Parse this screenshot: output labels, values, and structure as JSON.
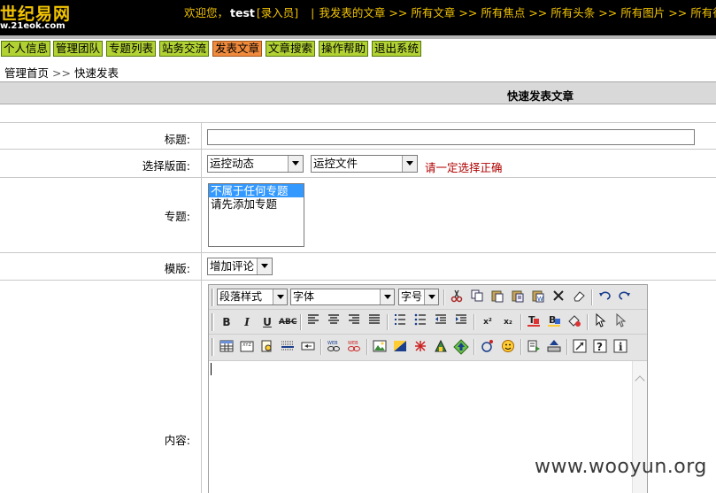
{
  "header": {
    "logo_text": "世纪易网",
    "logo_url": "w.21eok.com",
    "welcome_prefix": "欢迎您，",
    "username": "test",
    "role": "[录入员]",
    "links": [
      "我发表的文章",
      "所有文章",
      "所有焦点",
      "所有头条",
      "所有图片",
      "所有待审"
    ],
    "arrow": ">>"
  },
  "nav": {
    "buttons": [
      "个人信息",
      "管理团队",
      "专题列表",
      "站务交流",
      "发表文章",
      "文章搜索",
      "操作帮助",
      "退出系统"
    ],
    "active_index": 4
  },
  "breadcrumb": {
    "home": "管理首页",
    "arrow": ">>",
    "current": "快速发表"
  },
  "panel": {
    "title": "快速发表文章"
  },
  "form": {
    "title_label": "标题:",
    "title_value": "",
    "board_label": "选择版面:",
    "board_select_1": "运控动态",
    "board_select_2": "运控文件",
    "board_warning": "请一定选择正确",
    "topic_label": "专题:",
    "topic_options": [
      "不属于任何专题",
      "请先添加专题"
    ],
    "topic_selected_index": 0,
    "template_label": "模版:",
    "template_value": "增加评论",
    "content_label": "内容:"
  },
  "editor": {
    "paragraph_style": "段落样式",
    "font": "字体",
    "font_size": "字号",
    "bold_glyph": "B",
    "italic_glyph": "I",
    "underline_glyph": "U",
    "strike_glyph": "ABC",
    "superscript_glyph": "x²",
    "subscript_glyph": "x₂"
  },
  "watermark": "www.wooyun.org",
  "colors": {
    "header_bg": "#000000",
    "header_text": "#f2c300",
    "nav_button_bg": "#b2d234",
    "nav_button_active_bg": "#f08a3c",
    "warning_text": "#b00000",
    "title_bar_bg": "#d9d9d9"
  }
}
